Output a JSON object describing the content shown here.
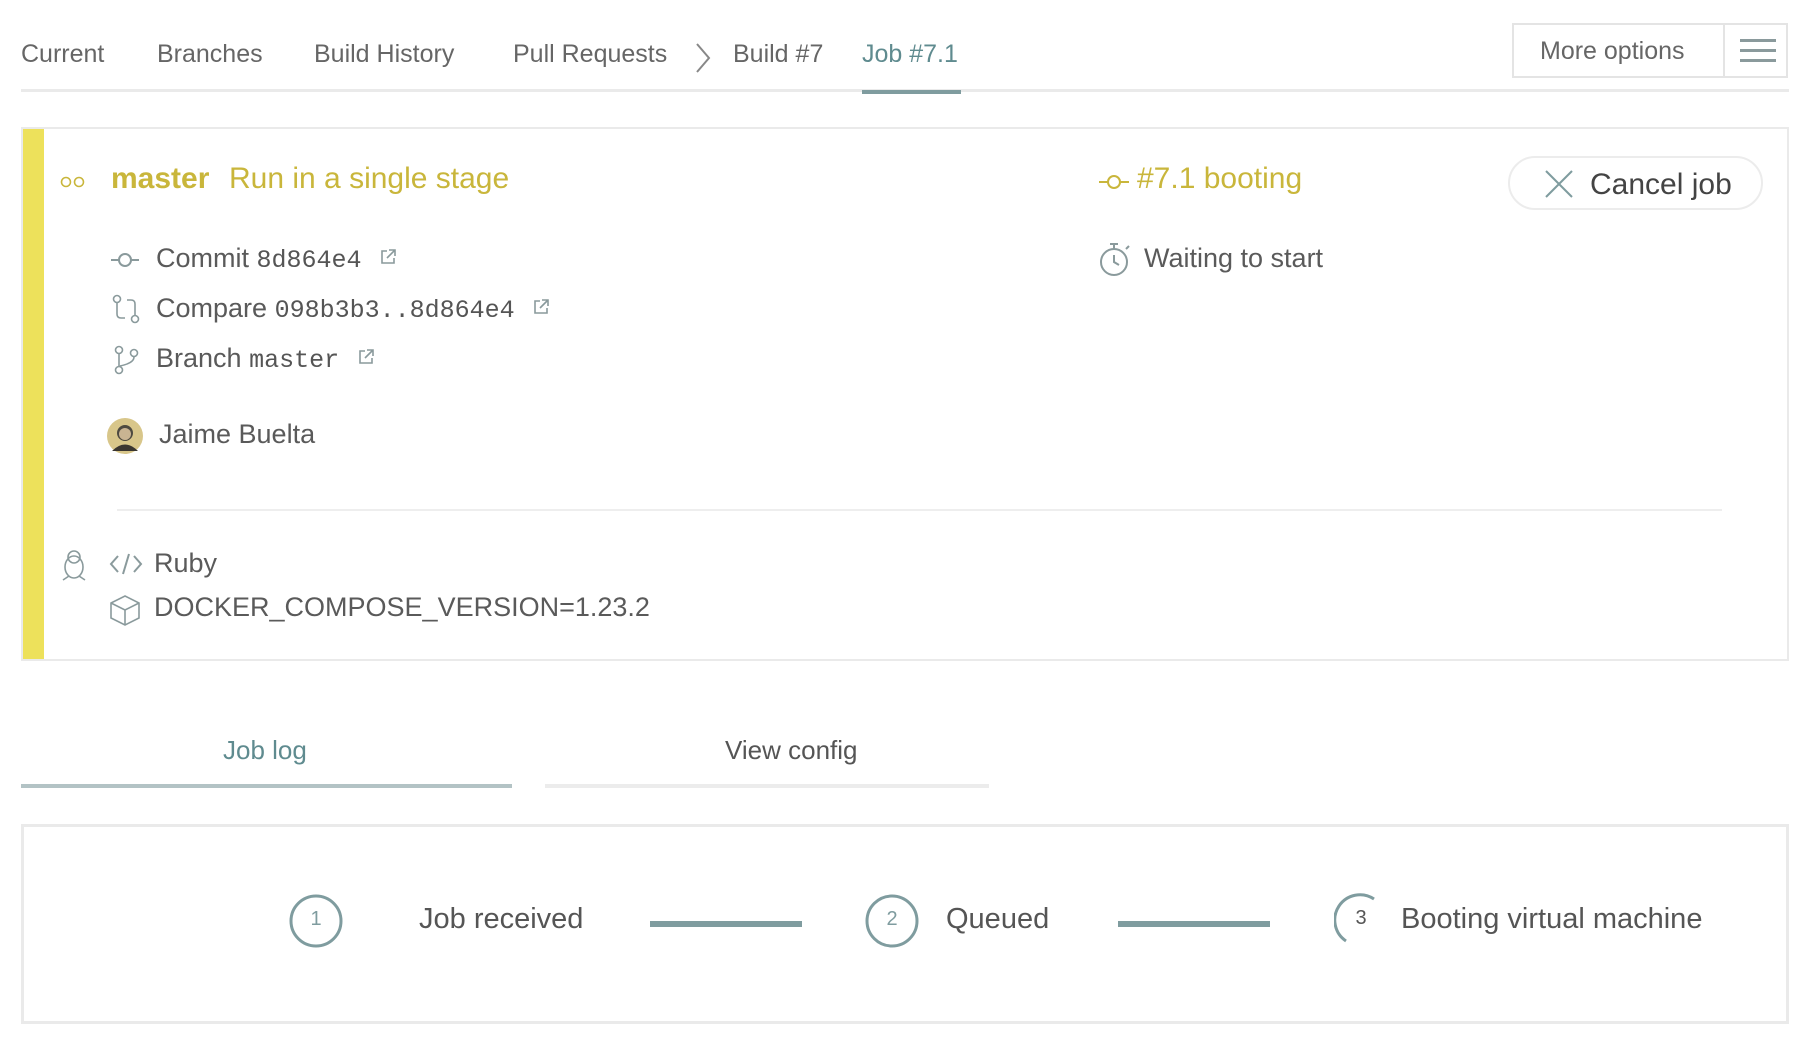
{
  "nav": {
    "tabs": [
      "Current",
      "Branches",
      "Build History",
      "Pull Requests",
      "Build #7",
      "Job #7.1"
    ],
    "active_tab": "Job #7.1",
    "more_options": "More options"
  },
  "job": {
    "branch": "master",
    "message": "Run in a single stage",
    "status": "#7.1 booting",
    "state": "Waiting to start",
    "commit_label": "Commit",
    "commit_sha": "8d864e4",
    "compare_label": "Compare",
    "compare_range": "098b3b3..8d864e4",
    "branch_label": "Branch",
    "branch_name": "master",
    "author": "Jaime Buelta",
    "cancel_label": "Cancel job",
    "language": "Ruby",
    "env": "DOCKER_COMPOSE_VERSION=1.23.2",
    "status_color": "#c9b63b",
    "stripe_color": "#ede15b"
  },
  "tabs": {
    "job_log": "Job log",
    "view_config": "View config"
  },
  "progress": {
    "steps": [
      {
        "number": "1",
        "label": "Job received"
      },
      {
        "number": "2",
        "label": "Queued"
      },
      {
        "number": "3",
        "label": "Booting virtual machine"
      }
    ],
    "accent": "#7f9c9f"
  }
}
